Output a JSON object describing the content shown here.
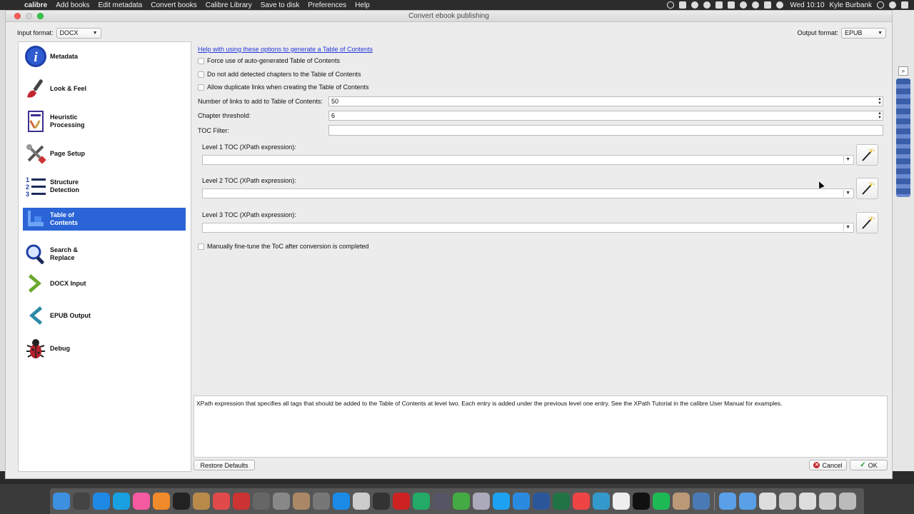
{
  "menubar": {
    "app_name": "calibre",
    "items": [
      "Add books",
      "Edit metadata",
      "Convert books",
      "Calibre Library",
      "Save to disk",
      "Preferences",
      "Help"
    ],
    "clock": "Wed 10:10",
    "user": "Kyle Burbank"
  },
  "dialog": {
    "title": "Convert ebook publishing",
    "input_format_label": "Input format:",
    "input_format_value": "DOCX",
    "output_format_label": "Output format:",
    "output_format_value": "EPUB"
  },
  "sidebar": {
    "items": [
      {
        "label": "Metadata",
        "icon": "info-icon"
      },
      {
        "label": "Look & Feel",
        "icon": "brush-icon"
      },
      {
        "label": "Heuristic Processing",
        "icon": "document-icon"
      },
      {
        "label": "Page Setup",
        "icon": "tools-icon"
      },
      {
        "label": "Structure Detection",
        "icon": "numbered-list-icon"
      },
      {
        "label": "Table of Contents",
        "icon": "toc-icon",
        "selected": true
      },
      {
        "label": "Search & Replace",
        "icon": "magnifier-icon"
      },
      {
        "label": "DOCX Input",
        "icon": "arrow-right-icon"
      },
      {
        "label": "EPUB Output",
        "icon": "arrow-left-icon"
      },
      {
        "label": "Debug",
        "icon": "bug-icon"
      }
    ]
  },
  "toc": {
    "help_link": "Help with using these options to generate a Table of Contents",
    "force_auto_label": "Force use of auto-generated Table of Contents",
    "no_detected_chapters_label": "Do not add detected chapters to the Table of Contents",
    "allow_duplicates_label": "Allow duplicate links when creating the Table of Contents",
    "num_links_label": "Number of links to add to Table of Contents:",
    "num_links_value": "50",
    "chapter_threshold_label": "Chapter threshold:",
    "chapter_threshold_value": "6",
    "toc_filter_label": "TOC Filter:",
    "level1_label": "Level 1 TOC (XPath expression):",
    "level2_label": "Level 2 TOC (XPath expression):",
    "level3_label": "Level 3 TOC (XPath expression):",
    "manual_finetune_label": "Manually fine-tune the ToC after conversion is completed"
  },
  "description": "XPath expression that specifies all tags that should be added to the Table of Contents at level two. Each entry is added under the previous level one entry. See the XPath Tutorial in the calibre User Manual for examples.",
  "buttons": {
    "restore_defaults": "Restore Defaults",
    "cancel": "Cancel",
    "ok": "OK"
  },
  "colors": {
    "selection": "#2a64d6",
    "link": "#2238d9"
  }
}
